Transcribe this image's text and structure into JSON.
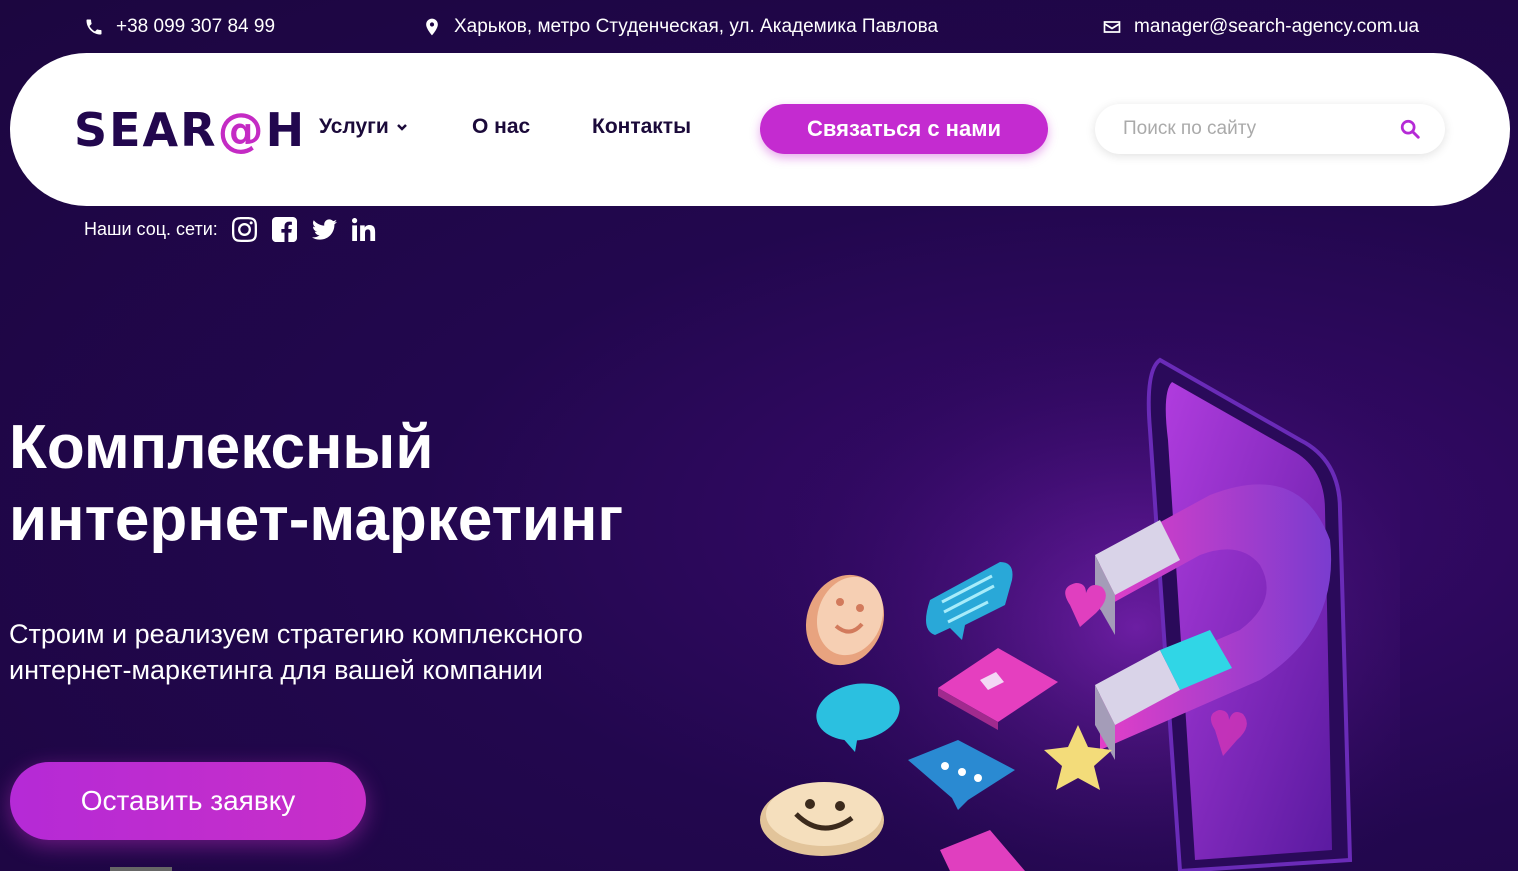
{
  "topbar": {
    "phone": "+38 099 307 84 99",
    "address": "Харьков, метро Студенческая, ул. Академика Павлова",
    "email": "manager@search-agency.com.ua"
  },
  "header": {
    "logo_left": "SEAR",
    "logo_at": "@",
    "logo_right": "H",
    "nav": [
      {
        "label": "Услуги"
      },
      {
        "label": "О нас"
      },
      {
        "label": "Контакты"
      }
    ],
    "cta_label": "Связаться с нами",
    "search_placeholder": "Поиск по сайту"
  },
  "socials": {
    "label": "Наши соц. сети:",
    "icons": [
      "instagram-icon",
      "facebook-icon",
      "twitter-icon",
      "linkedin-icon"
    ]
  },
  "hero": {
    "title_line1": "Комплексный",
    "title_line2": "интернет-маркетинг",
    "subtitle_line1": "Строим и реализуем стратегию комплексного",
    "subtitle_line2": "интернет-маркетинга для вашей компании",
    "button_label": "Оставить заявку"
  },
  "colors": {
    "background": "#22074e",
    "accent": "#c42bd0",
    "header_bg": "#ffffff",
    "nav_text": "#1b0a3a"
  }
}
